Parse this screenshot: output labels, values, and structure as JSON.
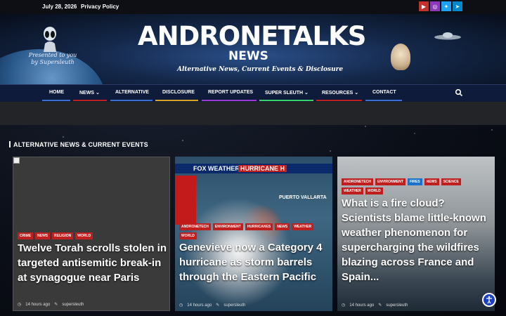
{
  "topbar": {
    "date": "July 28, 2026",
    "privacy_label": "Privacy Policy",
    "social": [
      {
        "icon": "youtube-icon",
        "color": "#c4302b",
        "glyph": "▶"
      },
      {
        "icon": "instagram-icon",
        "color": "#8a3ab9",
        "glyph": "◎"
      },
      {
        "icon": "twitter-icon",
        "color": "#1da1f2",
        "glyph": "✦"
      },
      {
        "icon": "telegram-icon",
        "color": "#0088cc",
        "glyph": "➤"
      }
    ]
  },
  "header": {
    "presented_by": "Presented to you by Supersleuth",
    "logo_main_a": "ANDRON",
    "logo_main_et": "ET",
    "logo_main_b": "ALKS",
    "logo_sub": "NEWS",
    "tagline": "Alternative News, Current Events & Disclosure"
  },
  "nav": {
    "items": [
      {
        "label": "HOME",
        "color": "#3b6fd1"
      },
      {
        "label": "NEWS ⌄",
        "color": "#c01f1f"
      },
      {
        "label": "ALTERNATIVE",
        "color": "#3b6fd1"
      },
      {
        "label": "DISCLOSURE",
        "color": "#d9a521"
      },
      {
        "label": "REPORT UPDATES",
        "color": "#9b3bd1"
      },
      {
        "label": "SUPER SLEUTH ⌄",
        "color": "#3bd16a"
      },
      {
        "label": "RESOURCES ⌄",
        "color": "#c01f1f"
      },
      {
        "label": "CONTACT",
        "color": "#3b6fd1"
      }
    ]
  },
  "section": {
    "title": "ALTERNATIVE NEWS & CURRENT EVENTS"
  },
  "cards": [
    {
      "tags": [
        "CRIME",
        "NEWS",
        "RELIGION",
        "WORLD"
      ],
      "title": "Twelve Torah scrolls stolen in targeted antisemitic break-in at synagogue near Paris",
      "time": "14 hours ago",
      "author": "supersleuth"
    },
    {
      "overlay_brand": "FOX WEATHER",
      "overlay_banner": "HURRICANE H",
      "overlay_place": "PUERTO VALLARTA",
      "tags": [
        "ANDRONETECH",
        "ENVIRONMENT",
        "HURRICANES",
        "NEWS",
        "WEATHER",
        "WORLD"
      ],
      "title": "Genevieve now a Category 4 hurricane as storm barrels through the Eastern Pacific",
      "time": "14 hours ago",
      "author": "supersleuth"
    },
    {
      "tags": [
        "ANDRONETECH",
        "ENVIRONMENT",
        "FIRES",
        "NEWS",
        "SCIENCE",
        "WEATHER",
        "WORLD"
      ],
      "title": "What is a fire cloud? Scientists blame little-known weather phenomenon for supercharging the wildfires blazing across France and Spain...",
      "time": "14 hours ago",
      "author": "supersleuth"
    }
  ],
  "colors": {
    "tag_red": "#c01f1f",
    "tag_blue": "#1c72c9",
    "nav_bg": "#0e1b3a"
  }
}
